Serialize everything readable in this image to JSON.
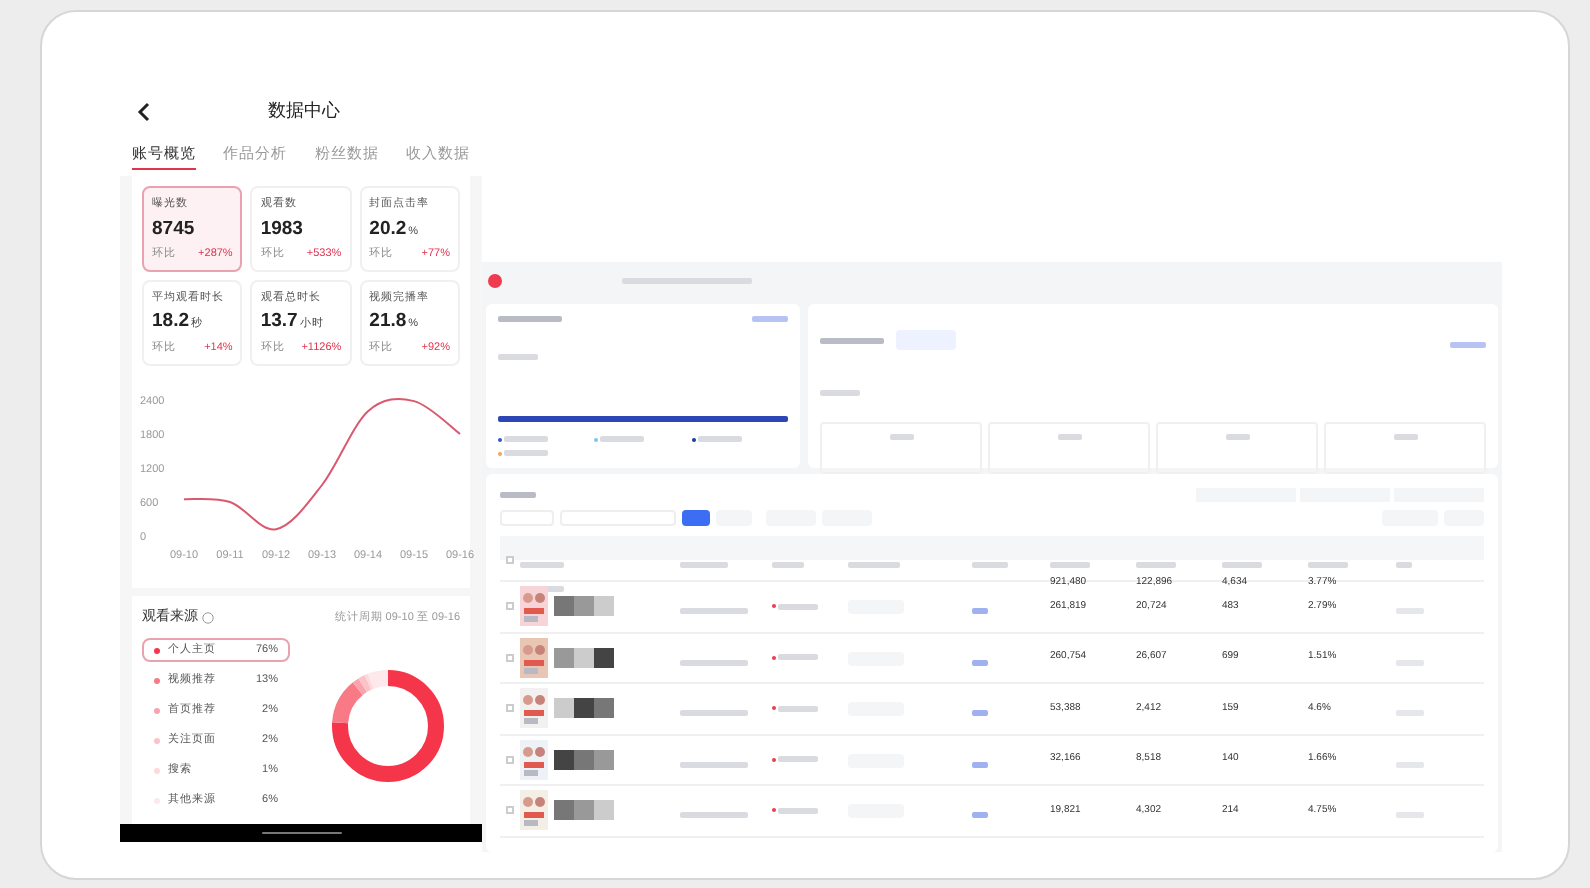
{
  "phone": {
    "title": "数据中心",
    "tabs": [
      {
        "label": "账号概览",
        "selected": true
      },
      {
        "label": "作品分析",
        "selected": false
      },
      {
        "label": "粉丝数据",
        "selected": false
      },
      {
        "label": "收入数据",
        "selected": false
      }
    ],
    "metrics": [
      {
        "label": "曝光数",
        "value": "8745",
        "compare": "环比",
        "change": "+287%",
        "selected": true
      },
      {
        "label": "观看数",
        "value": "1983",
        "compare": "环比",
        "change": "+533%",
        "selected": false
      },
      {
        "label": "封面点击率",
        "value": "20.2",
        "unit": "%",
        "compare": "环比",
        "change": "+77%",
        "selected": false
      },
      {
        "label": "平均观看时长",
        "value": "18.2",
        "unit": "秒",
        "compare": "环比",
        "change": "+14%",
        "selected": false
      },
      {
        "label": "观看总时长",
        "value": "13.7",
        "unit": "小时",
        "compare": "环比",
        "change": "+1126%",
        "selected": false
      },
      {
        "label": "视频完播率",
        "value": "21.8",
        "unit": "%",
        "compare": "环比",
        "change": "+92%",
        "selected": false
      }
    ],
    "chart_data": {
      "type": "line",
      "categories": [
        "09-10",
        "09-11",
        "09-12",
        "09-13",
        "09-14",
        "09-15",
        "09-16"
      ],
      "yticks": [
        0,
        600,
        1200,
        1800,
        2400
      ],
      "ylim": [
        0,
        2400
      ],
      "series": [
        {
          "color": "#d9596f",
          "values": [
            650,
            600,
            120,
            900,
            2200,
            2380,
            1800
          ]
        }
      ]
    },
    "sources": {
      "title": "观看来源",
      "period": "统计周期 09-10 至 09-16",
      "items": [
        {
          "label": "个人主页",
          "value": "76%",
          "color": "#f5364a",
          "selected": true
        },
        {
          "label": "视频推荐",
          "value": "13%",
          "color": "#f77a86",
          "selected": false
        },
        {
          "label": "首页推荐",
          "value": "2%",
          "color": "#f9a3ad",
          "selected": false
        },
        {
          "label": "关注页面",
          "value": "2%",
          "color": "#fbc2c8",
          "selected": false
        },
        {
          "label": "搜索",
          "value": "1%",
          "color": "#fdd9dd",
          "selected": false
        },
        {
          "label": "其他来源",
          "value": "6%",
          "color": "#fde9eb",
          "selected": false
        }
      ]
    }
  },
  "dashboard": {
    "legend": [
      {
        "color": "#3056d3"
      },
      {
        "color": "#7cc7f2"
      },
      {
        "color": "#1d3a9e"
      },
      {
        "color": "#f5a25d"
      }
    ],
    "table": {
      "all_checked": false,
      "summary": [
        "921,480",
        "122,896",
        "4,634",
        "3.77%"
      ],
      "rows": [
        {
          "checked": false,
          "cells": [
            "261,819",
            "20,724",
            "483",
            "2.79%"
          ]
        },
        {
          "checked": false,
          "cells": [
            "260,754",
            "26,607",
            "699",
            "1.51%"
          ]
        },
        {
          "checked": false,
          "cells": [
            "53,388",
            "2,412",
            "159",
            "4.6%"
          ]
        },
        {
          "checked": false,
          "cells": [
            "32,166",
            "8,518",
            "140",
            "1.66%"
          ]
        },
        {
          "checked": false,
          "cells": [
            "19,821",
            "4,302",
            "214",
            "4.75%"
          ]
        }
      ]
    }
  }
}
